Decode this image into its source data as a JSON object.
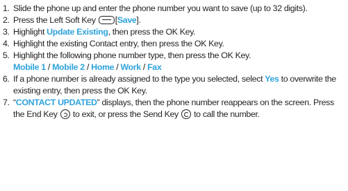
{
  "steps": [
    {
      "num": "1.",
      "text": "Slide the phone up and enter the phone number you want to save (up to 32 digits)."
    },
    {
      "num": "2.",
      "prefix": "Press the Left Soft Key",
      "open_bracket": "[",
      "highlight": "Save",
      "close": "]."
    },
    {
      "num": "3.",
      "prefix": "Highlight",
      "highlight": "Update Existing",
      "suffix": ", then press the OK Key."
    },
    {
      "num": "4.",
      "text": "Highlight the existing Contact entry, then press the OK Key."
    },
    {
      "num": "5.",
      "text": "Highlight the following phone number type, then press the OK Key.",
      "options": [
        "Mobile 1",
        "Mobile 2",
        "Home",
        "Work",
        "Fax"
      ],
      "separator": "/"
    },
    {
      "num": "6.",
      "prefix": "If a phone number is already assigned to the type you selected, select",
      "highlight": "Yes",
      "suffix": "to overwrite the existing entry, then press the OK Key."
    },
    {
      "num": "7.",
      "open_quote": "“",
      "highlight": "CONTACT UPDATED",
      "part1": "” displays, then the phone number reappears on the screen. Press the End Key",
      "part2": "to exit, or press the Send Key",
      "part3": "to call the number."
    }
  ],
  "icons": {
    "left_soft_key": "left-soft-key-icon",
    "end_key": "end-key-icon",
    "send_key": "send-key-icon"
  },
  "colors": {
    "highlight": "#2ea3dc",
    "text": "#231f20"
  }
}
